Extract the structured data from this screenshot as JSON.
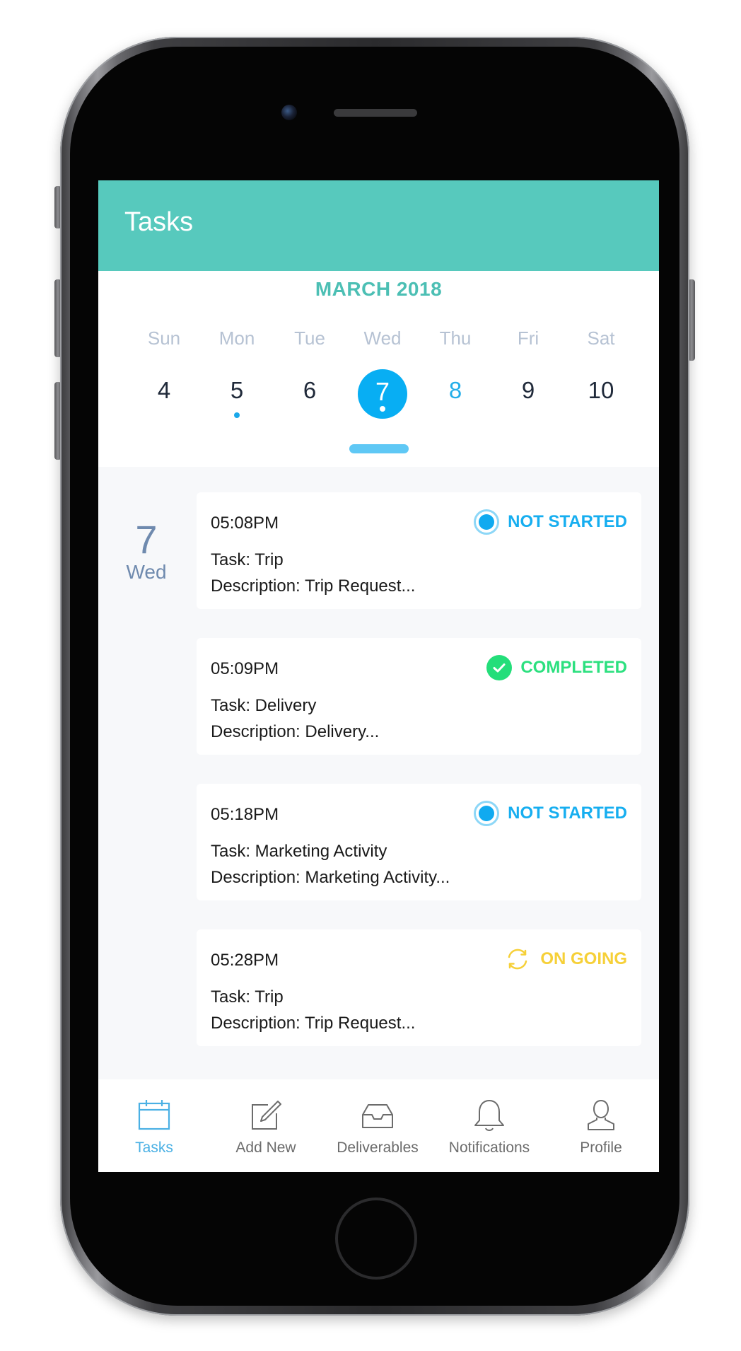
{
  "header": {
    "title": "Tasks"
  },
  "calendar": {
    "month": "MARCH 2018",
    "days": [
      {
        "name": "Sun",
        "num": "4"
      },
      {
        "name": "Mon",
        "num": "5"
      },
      {
        "name": "Tue",
        "num": "6"
      },
      {
        "name": "Wed",
        "num": "7"
      },
      {
        "name": "Thu",
        "num": "8"
      },
      {
        "name": "Fri",
        "num": "9"
      },
      {
        "name": "Sat",
        "num": "10"
      }
    ],
    "selected_day": "7",
    "days_with_tasks": [
      "5",
      "7"
    ]
  },
  "task_day": {
    "num": "7",
    "name": "Wed"
  },
  "tasks": [
    {
      "time": "05:08PM",
      "task": "Task: Trip",
      "description": "Description: Trip Request...",
      "status": "NOT STARTED"
    },
    {
      "time": "05:09PM",
      "task": "Task: Delivery",
      "description": "Description: Delivery...",
      "status": "COMPLETED"
    },
    {
      "time": "05:18PM",
      "task": "Task: Marketing Activity",
      "description": "Description: Marketing Activity...",
      "status": "NOT STARTED"
    },
    {
      "time": "05:28PM",
      "task": "Task: Trip",
      "description": "Description: Trip Request...",
      "status": "ON GOING"
    }
  ],
  "nav": [
    {
      "label": "Tasks",
      "icon": "calendar-icon",
      "active": true
    },
    {
      "label": "Add New",
      "icon": "edit-icon",
      "active": false
    },
    {
      "label": "Deliverables",
      "icon": "inbox-icon",
      "active": false
    },
    {
      "label": "Notifications",
      "icon": "bell-icon",
      "active": false
    },
    {
      "label": "Profile",
      "icon": "user-icon",
      "active": false
    }
  ],
  "colors": {
    "header": "#57c9bd",
    "accent": "#08aef3",
    "not_started": "#16aef0",
    "completed": "#2ce07f",
    "ongoing": "#f6d038"
  }
}
